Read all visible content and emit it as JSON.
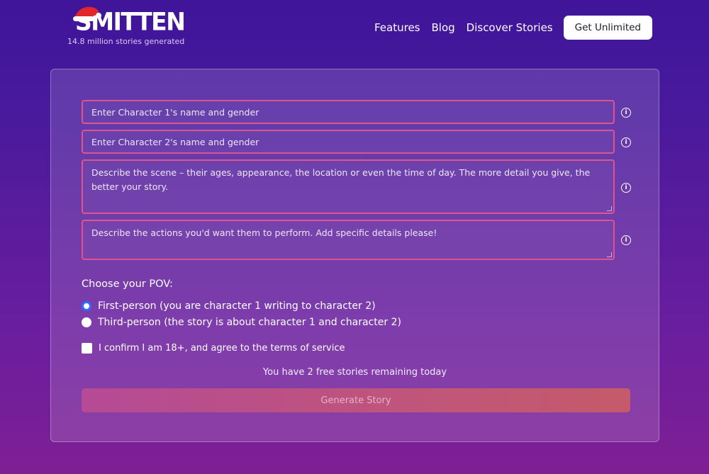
{
  "header": {
    "brand": "SMITTEN",
    "tagline": "14.8 million stories generated",
    "nav": [
      "Features",
      "Blog",
      "Discover Stories"
    ],
    "cta_label": "Get Unlimited"
  },
  "form": {
    "character1_placeholder": "Enter Character 1's name and gender",
    "character2_placeholder": "Enter Character 2's name and gender",
    "scene_placeholder": "Describe the scene – their ages, appearance, the location or even the time of day. The more detail you give, the better your story.",
    "actions_placeholder": "Describe the actions you'd want them to perform. Add specific details please!",
    "pov_label": "Choose your POV:",
    "pov_options": [
      {
        "label": "First-person (you are character 1 writing to character 2)",
        "checked": true
      },
      {
        "label": "Third-person (the story is about character 1 and character 2)",
        "checked": false
      }
    ],
    "confirm_label": "I confirm I am 18+, and agree to the terms of service",
    "remaining_text": "You have 2 free stories remaining today",
    "generate_label": "Generate Story"
  },
  "colors": {
    "field_border": "#e0538f",
    "radio_selected": "#2f6bff",
    "info_icon": "info-circle-icon"
  }
}
